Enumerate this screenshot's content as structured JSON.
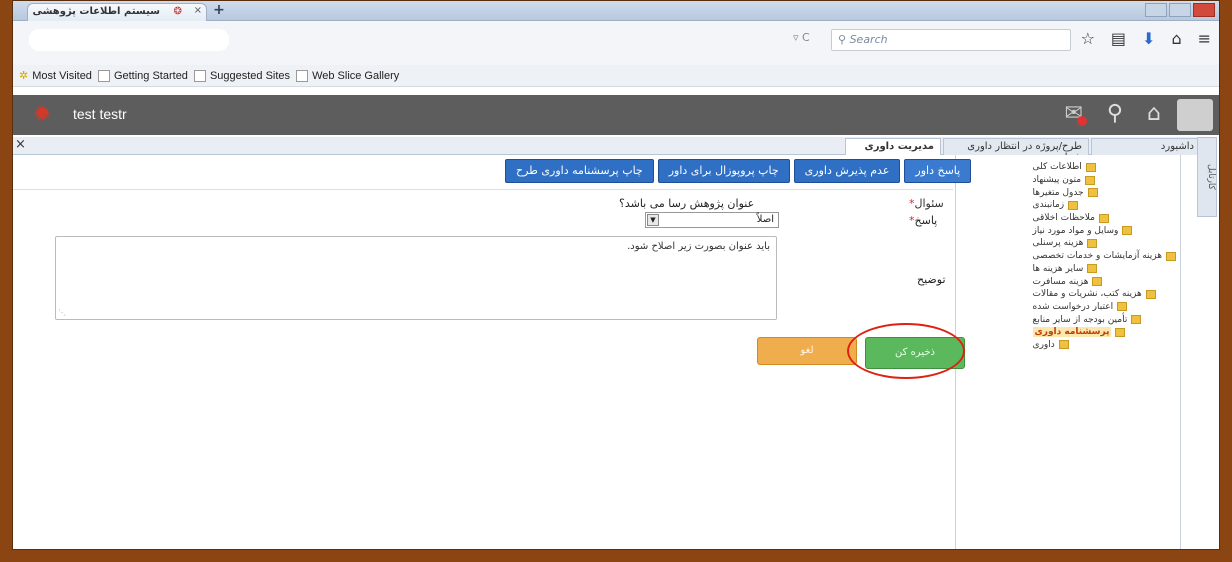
{
  "browser": {
    "tab_title": "سیستم اطلاعات پژوهشی",
    "tab_close": "×",
    "new_tab": "+",
    "search_placeholder": "Search",
    "url_tools": "▿ C"
  },
  "bookmarks": {
    "items": [
      "Most Visited",
      "Getting Started",
      "Suggested Sites",
      "Web Slice Gallery"
    ]
  },
  "header": {
    "user": "test testr"
  },
  "tabs": {
    "close": "×",
    "items": [
      {
        "label": "داشبورد"
      },
      {
        "label": "طرح/پروژه در انتظار داوری شما"
      },
      {
        "label": "مدیریت داوری"
      }
    ]
  },
  "side_tab": {
    "label": "کارتابل"
  },
  "menu": {
    "items": [
      "اطلاعات کلی",
      "متون پیشنهاد",
      "جدول متغیرها",
      "زمانبندی",
      "ملاحظات اخلاقی",
      "وسایل و مواد مورد نیاز",
      "هزینه پرسنلی",
      "هزینه آزمایشات و خدمات تخصصی",
      "سایر هزینه ها",
      "هزینه مسافرت",
      "هزینه کتب، نشریات و مقالات",
      "اعتبار درخواست شده",
      "تأمین بودجه از سایر منابع",
      "پرسشنامه داوری",
      "داوری"
    ],
    "selected_index": 13
  },
  "toolbar": {
    "reply": "پاسخ داور",
    "reject": "عدم پذیرش داوری",
    "print_proposal": "چاپ پروپوزال برای داور",
    "print_questionnaire": "چاپ پرسشنامه داوری طرح"
  },
  "form": {
    "question_label": "سئوال",
    "question_text": "عنوان پژوهش رسا می باشد؟",
    "answer_label": "پاسخ",
    "answer_value": "اصلاً",
    "description_label": "توضیح",
    "description_value": "باید عنوان بصورت زیر اصلاح شود.",
    "required_mark": "*"
  },
  "actions": {
    "save": "ذخیره کن",
    "cancel": "لغو"
  },
  "colors": {
    "frame": "#8b4513",
    "primary_button": "#2f6fc4",
    "save_button": "#5cb85c",
    "cancel_button": "#f0ad4e",
    "annotation_circle": "#d21111"
  }
}
